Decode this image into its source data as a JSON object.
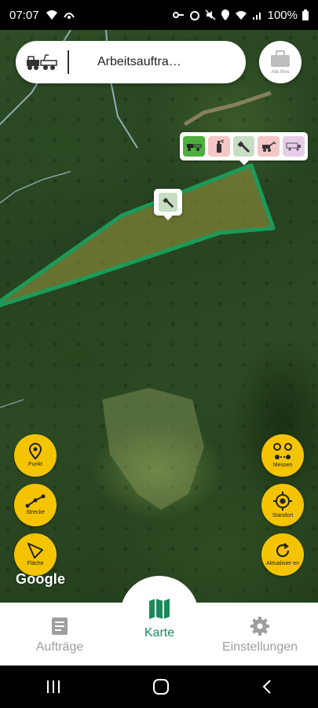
{
  "status_bar": {
    "time": "07:07",
    "battery": "100%"
  },
  "search": {
    "title": "Arbeitsauftra…"
  },
  "all_pins": {
    "label": "Alle Pins"
  },
  "tools": {
    "colors": [
      "#4caf3c",
      "#f4c7c7",
      "#c8dec4",
      "#f4c7c7",
      "#e8cdea"
    ]
  },
  "map_buttons": {
    "punkt": "Punkt",
    "strecke": "Strecke",
    "flaeche": "Fläche",
    "messen": "Messen",
    "standort": "Standort",
    "aktualisieren": "Aktualisier en"
  },
  "map": {
    "attribution": "Google",
    "area_color": "#1b9a5a"
  },
  "nav": {
    "auftraege": "Aufträge",
    "karte": "Karte",
    "einstellungen": "Einstellungen",
    "active_color": "#1b8a5a"
  }
}
